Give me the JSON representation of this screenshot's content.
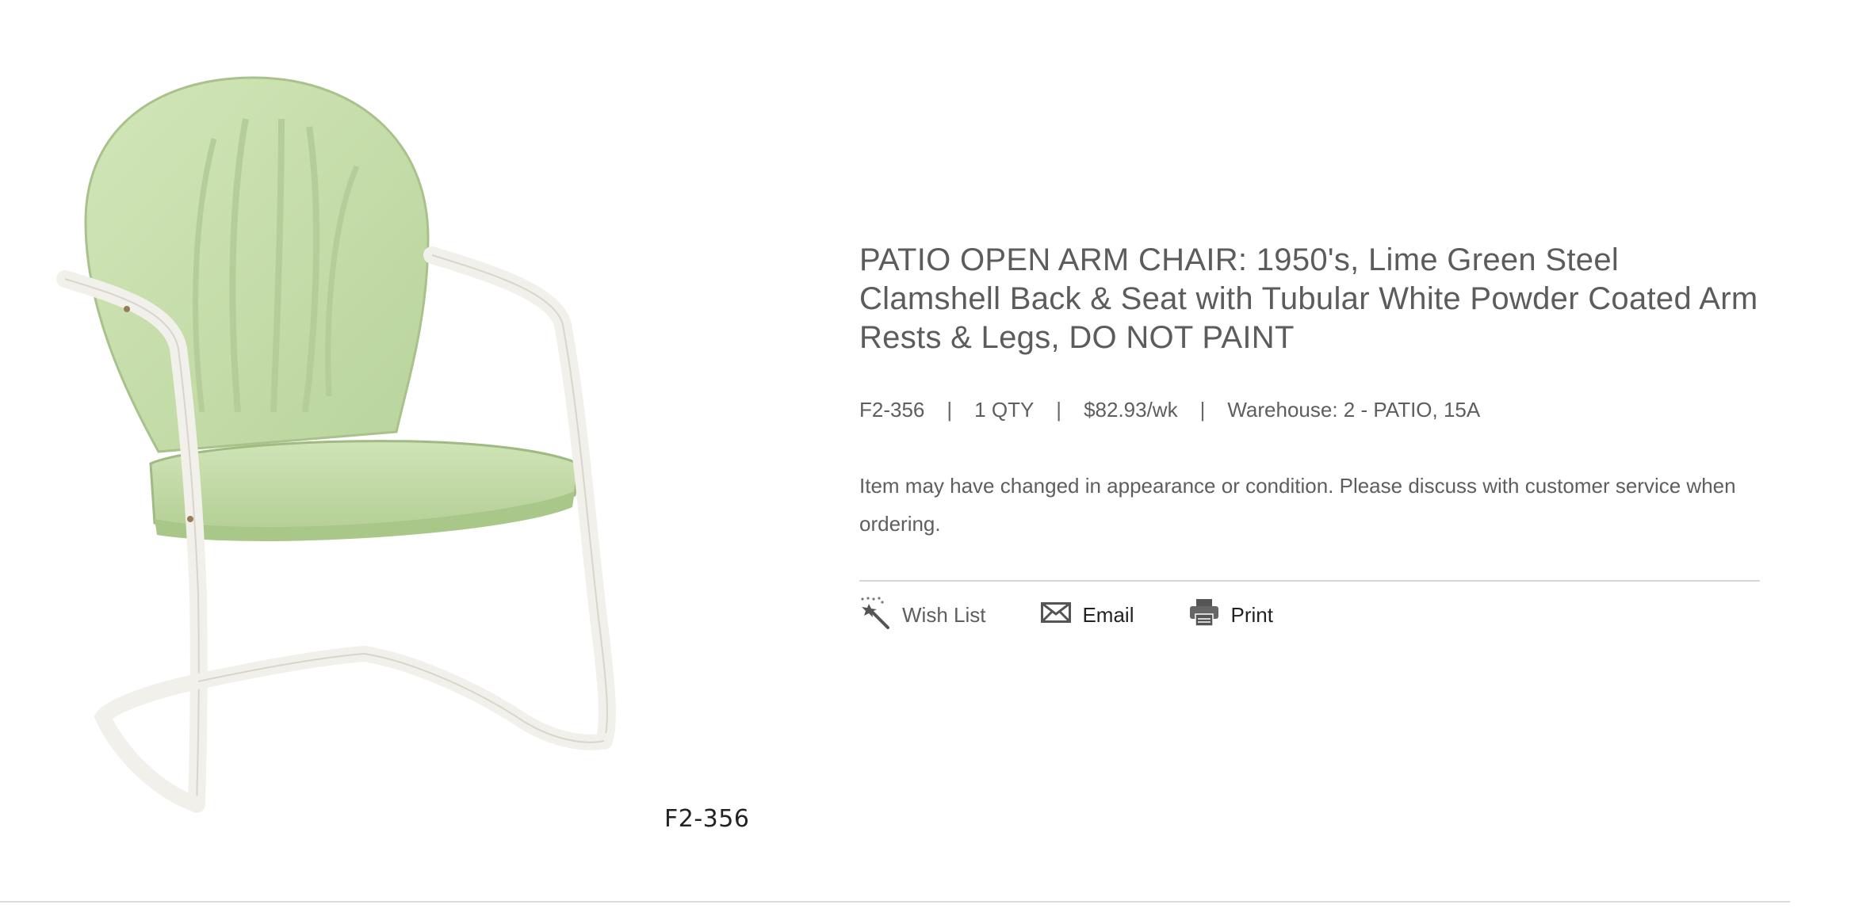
{
  "product": {
    "image_alt": "Lime green steel clamshell patio arm chair with white tubular frame",
    "image_code_label": "F2-356",
    "title": "PATIO OPEN ARM CHAIR: 1950's, Lime Green Steel Clamshell Back & Seat with Tubular White Powder Coated Arm Rests & Legs, DO NOT PAINT",
    "sku": "F2-356",
    "qty": "1 QTY",
    "price": "$82.93/wk",
    "warehouse": "Warehouse: 2 - PATIO, 15A",
    "separator": "|",
    "note": "Item may have changed in appearance or condition. Please discuss with customer service when ordering."
  },
  "actions": {
    "wish_list": {
      "label": "Wish List",
      "icon": "magic-wand-icon"
    },
    "email": {
      "label": "Email",
      "icon": "envelope-icon"
    },
    "print": {
      "label": "Print",
      "icon": "printer-icon"
    }
  },
  "colors": {
    "chair_green": "#c8deae",
    "frame_white": "#f2f0ea",
    "text": "#5c5c5c"
  }
}
